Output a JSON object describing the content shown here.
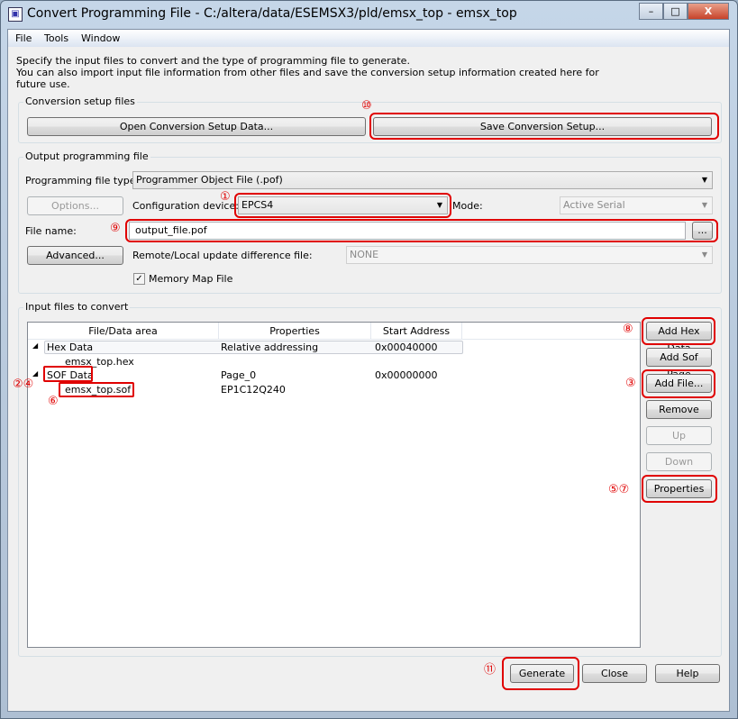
{
  "window": {
    "title": "Convert Programming File - C:/altera/data/ESEMSX3/pld/emsx_top - emsx_top",
    "min": "–",
    "max": "□",
    "close": "X"
  },
  "menu": [
    "File",
    "Tools",
    "Window"
  ],
  "description": [
    "Specify the input files to convert and the type of programming file to generate.",
    "You can also import input file information from other files and save the conversion setup information created here for",
    "future use."
  ],
  "setup": {
    "label": "Conversion setup files",
    "open": "Open Conversion Setup Data...",
    "save": "Save Conversion Setup..."
  },
  "output": {
    "label": "Output programming file",
    "type_label": "Programming file type:",
    "type_value": "Programmer Object File (.pof)",
    "options": "Options...",
    "device_label": "Configuration device:",
    "device_value": "EPCS4",
    "mode_label": "Mode:",
    "mode_value": "Active Serial",
    "filename_label": "File name:",
    "filename_value": "output_file.pof",
    "browse": "...",
    "advanced": "Advanced...",
    "diff_label": "Remote/Local update difference file:",
    "diff_value": "NONE",
    "memmap_label": "Memory Map File",
    "memmap_checked": true
  },
  "input": {
    "label": "Input files to convert",
    "columns": [
      "File/Data area",
      "Properties",
      "Start Address"
    ],
    "rows": [
      {
        "name": "Hex Data",
        "props": "Relative addressing",
        "addr": "0x00040000"
      },
      {
        "name": "emsx_top.hex",
        "props": "",
        "addr": ""
      },
      {
        "name": "SOF Data",
        "props": "Page_0",
        "addr": "0x00000000"
      },
      {
        "name": "emsx_top.sof",
        "props": "EP1C12Q240",
        "addr": ""
      }
    ],
    "buttons": {
      "add_hex": "Add Hex Data",
      "add_sof": "Add Sof Page",
      "add_file": "Add File...",
      "remove": "Remove",
      "up": "Up",
      "down": "Down",
      "properties": "Properties"
    }
  },
  "footer": {
    "generate": "Generate",
    "close": "Close",
    "help": "Help"
  },
  "annotations": {
    "a1": "①",
    "a2_4": "②④",
    "a3": "③",
    "a5_7": "⑤⑦",
    "a6": "⑥",
    "a8": "⑧",
    "a9": "⑨",
    "a10": "⑩",
    "a11": "⑪"
  },
  "colors": {
    "annotation": "#e00000"
  }
}
